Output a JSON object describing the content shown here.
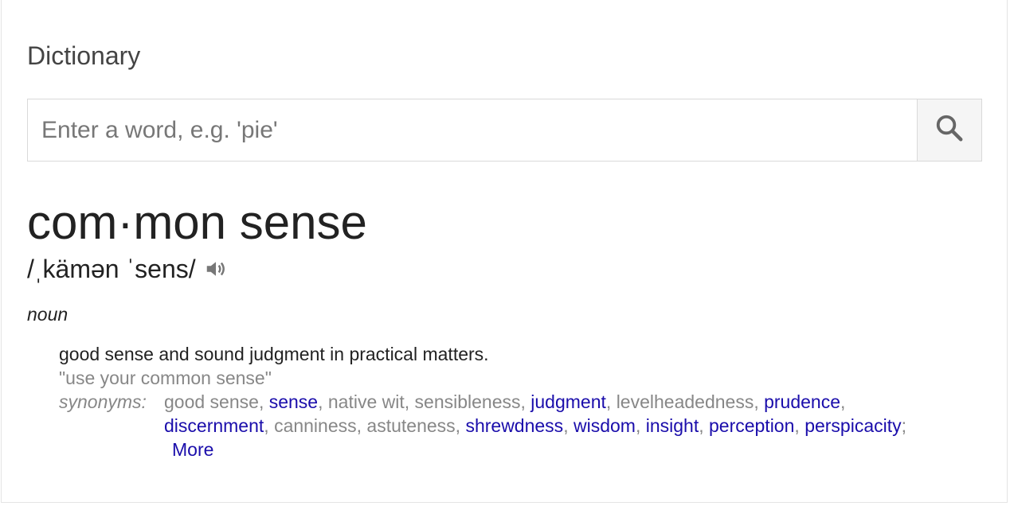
{
  "widget": {
    "title": "Dictionary"
  },
  "search": {
    "placeholder": "Enter a word, e.g. 'pie'",
    "value": "",
    "icon": "search-icon"
  },
  "entry": {
    "headword": "com·mon sense",
    "phonetic": "/ˌkämən ˈsens/",
    "audio_icon": "speaker-icon",
    "part_of_speech": "noun",
    "definition": "good sense and sound judgment in practical matters.",
    "example": "\"use your common sense\"",
    "synonyms_label": "synonyms:",
    "synonyms": [
      {
        "text": "good sense",
        "link": false
      },
      {
        "text": "sense",
        "link": true
      },
      {
        "text": "native wit",
        "link": false
      },
      {
        "text": "sensibleness",
        "link": false
      },
      {
        "text": "judgment",
        "link": true
      },
      {
        "text": "levelheadedness",
        "link": false
      },
      {
        "text": "prudence",
        "link": true
      },
      {
        "text": "discernment",
        "link": true
      },
      {
        "text": "canniness",
        "link": false
      },
      {
        "text": "astuteness",
        "link": false
      },
      {
        "text": "shrewdness",
        "link": true
      },
      {
        "text": "wisdom",
        "link": true
      },
      {
        "text": "insight",
        "link": true
      },
      {
        "text": "perception",
        "link": true
      },
      {
        "text": "perspicacity",
        "link": true
      }
    ],
    "more_label": "More"
  },
  "colors": {
    "link": "#1a0dab",
    "muted": "#878787",
    "text": "#222222"
  }
}
